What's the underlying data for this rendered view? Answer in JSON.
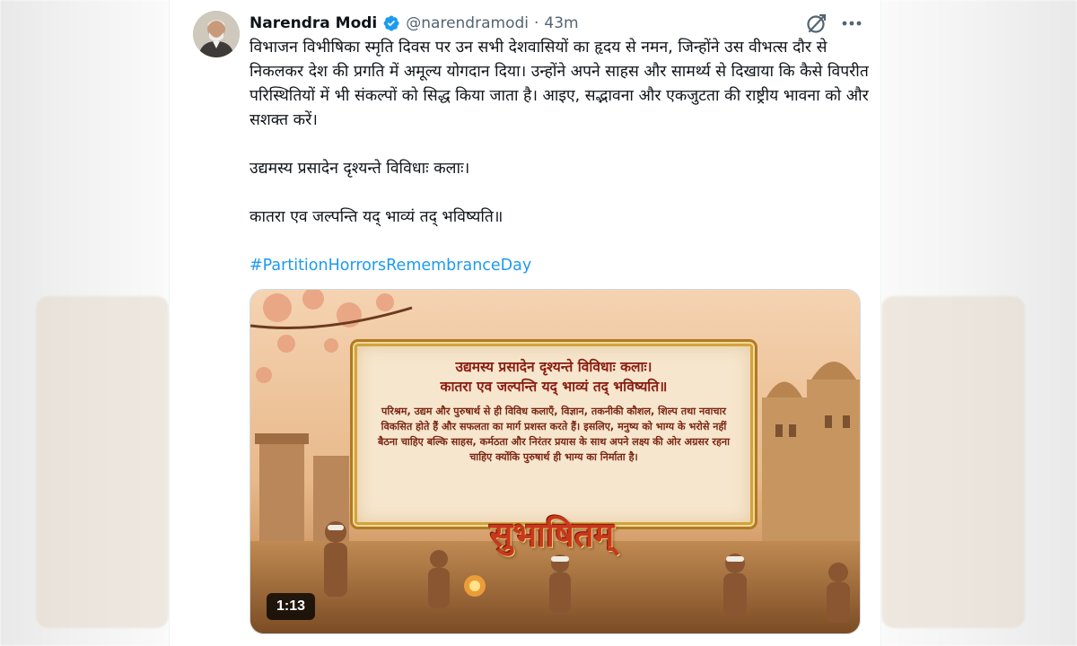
{
  "author": {
    "name": "Narendra Modi",
    "handle": "@narendramodi",
    "separator": "·",
    "time": "43m",
    "verified_color": "#1d9bf0"
  },
  "icons": [
    "grok-icon",
    "more-icon",
    "verified-badge-icon"
  ],
  "tweet": {
    "paragraph1": "विभाजन विभीषिका स्मृति दिवस पर उन सभी देशवासियों का हृदय से नमन, जिन्होंने उस वीभत्स दौर से निकलकर देश की प्रगति में अमूल्य योगदान दिया। उन्होंने अपने साहस और सामर्थ्य से दिखाया कि कैसे विपरीत परिस्थितियों में भी संकल्पों को सिद्ध किया जाता है। आइए, सद्भावना और एकजुटता की राष्ट्रीय भावना को और सशक्त करें।",
    "paragraph2": "उद्यमस्य प्रसादेन दृश्यन्ते विविधाः कलाः।",
    "paragraph3": "कातरा एव जल्पन्ति यद् भाव्यं तद् भविष्यति॥",
    "hashtag": "#PartitionHorrorsRemembranceDay",
    "hashtag_color": "#1d9bf0"
  },
  "media": {
    "shloka_line1": "उद्यमस्य प्रसादेन दृश्यन्ते विविधाः कलाः।",
    "shloka_line2": "कातरा एव जल्पन्ति यद् भाव्यं तद् भविष्यति॥",
    "meaning": "परिश्रम, उद्यम और पुरुषार्थ से ही विविध कलाएँ, विज्ञान, तकनीकी कौशल, शिल्प तथा नवाचार विकसित होते हैं और सफलता का मार्ग प्रशस्त करते हैं। इसलिए, मनुष्य को भाग्य के भरोसे नहीं बैठना चाहिए बल्कि साहस, कर्मठता और निरंतर प्रयास के साथ अपने लक्ष्य की ओर अग्रसर रहना चाहिए क्योंकि पुरुषार्थ ही भाग्य का निर्माता है।",
    "title_art": "सुभाषितम्",
    "duration": "1:13"
  }
}
